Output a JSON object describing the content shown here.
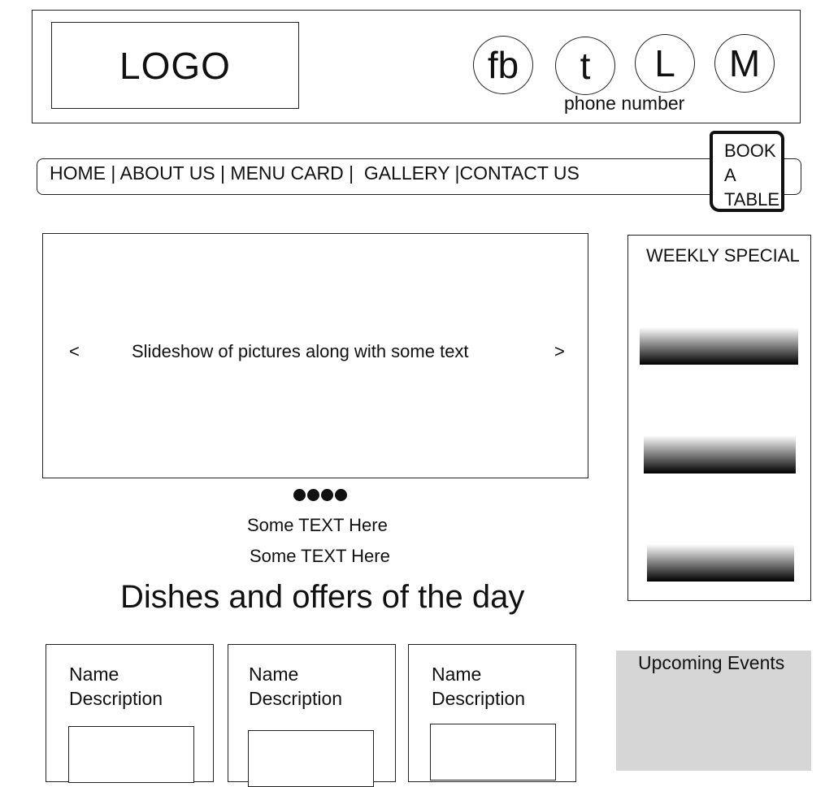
{
  "header": {
    "logo": "LOGO",
    "social": [
      {
        "label": "fb",
        "icon": "facebook-icon"
      },
      {
        "label": "t",
        "icon": "twitter-icon"
      },
      {
        "label": "L",
        "icon": "linkedin-icon"
      },
      {
        "label": "M",
        "icon": "mail-icon"
      }
    ],
    "phone": "phone number"
  },
  "nav": {
    "items": [
      "HOME |",
      " ABOUT US |",
      " MENU CARD |",
      "  GALLERY |",
      "CONTACT US"
    ],
    "book_button": [
      "BOOK",
      "A",
      "TABLE"
    ]
  },
  "slideshow": {
    "prev": "<",
    "next": ">",
    "text": "Slideshow of pictures along with some text",
    "dot_count": 4
  },
  "intro_text": [
    "Some TEXT Here",
    "Some TEXT Here"
  ],
  "dishes": {
    "title": "Dishes and offers of the day",
    "cards": [
      {
        "name": "Name",
        "description": "Description"
      },
      {
        "name": "Name",
        "description": "Description"
      },
      {
        "name": "Name",
        "description": "Description"
      }
    ]
  },
  "weekly_special": {
    "title": "WEEKLY SPECIAL"
  },
  "upcoming_events": {
    "title": "Upcoming Events"
  }
}
